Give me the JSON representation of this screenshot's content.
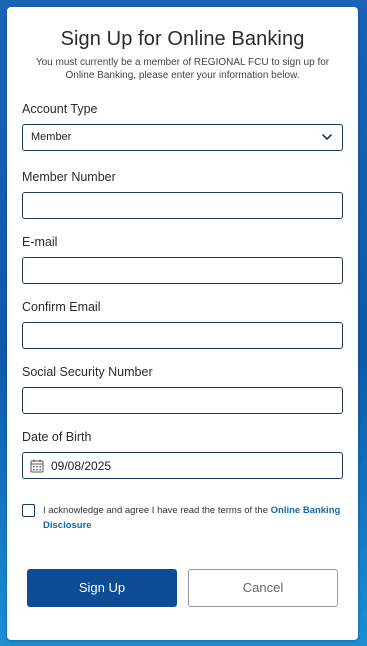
{
  "header": {
    "title": "Sign Up for Online Banking",
    "subtitle": "You must currently be a member of REGIONAL FCU to sign up for Online Banking, please enter your information below."
  },
  "form": {
    "account_type": {
      "label": "Account Type",
      "value": "Member",
      "icon": "chevron-down-icon"
    },
    "member_number": {
      "label": "Member Number",
      "value": ""
    },
    "email": {
      "label": "E-mail",
      "value": ""
    },
    "confirm_email": {
      "label": "Confirm Email",
      "value": ""
    },
    "ssn": {
      "label": "Social Security Number",
      "value": ""
    },
    "dob": {
      "label": "Date of Birth",
      "value": "09/08/2025",
      "icon": "calendar-icon"
    },
    "acknowledge": {
      "text": "I acknowledge and agree I have read the terms of the ",
      "link": "Online Banking Disclosure",
      "checked": false
    }
  },
  "buttons": {
    "sign_up": "Sign Up",
    "cancel": "Cancel"
  },
  "colors": {
    "primary": "#0f4c96",
    "link": "#136aa8",
    "border": "#1c3a5a",
    "background_gradient_top": "#1a63b5",
    "background_gradient_bottom": "#1b8fd6"
  }
}
